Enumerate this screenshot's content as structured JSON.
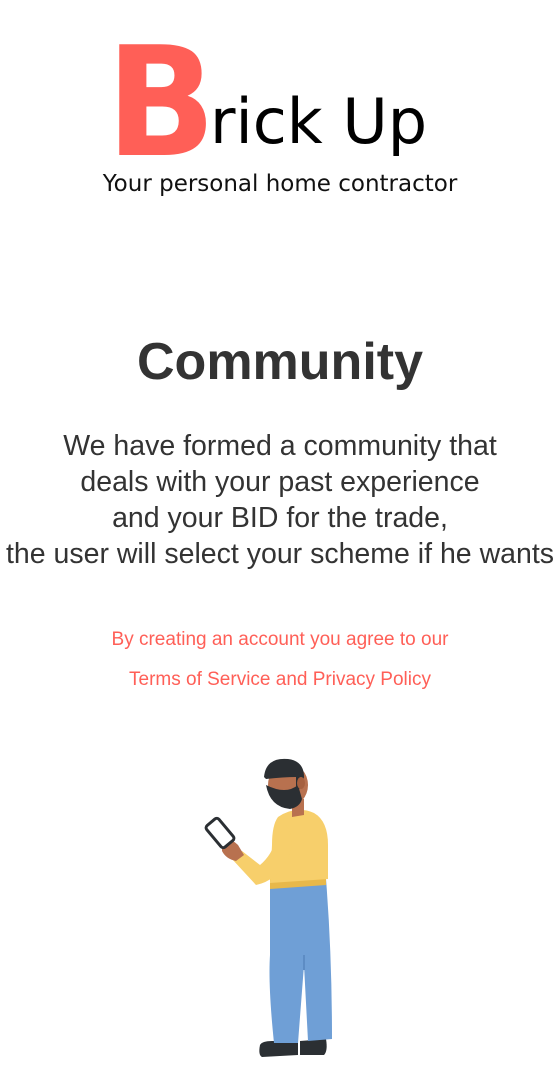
{
  "logo": {
    "initial": "B",
    "rest": "rick Up",
    "accent_color": "#ff5f57"
  },
  "tagline": "Your personal home contractor",
  "title": "Community",
  "description": {
    "lines": [
      "We have formed a community that",
      "deals with your past experience",
      "and your BID for the trade,",
      "the user will select your scheme if he wants"
    ]
  },
  "terms": {
    "line1": "By creating an account you agree to our",
    "link": "Terms of Service and Privacy Policy",
    "color": "#ff5f57"
  },
  "illustration": {
    "icon": "man-using-phone-illustration"
  }
}
